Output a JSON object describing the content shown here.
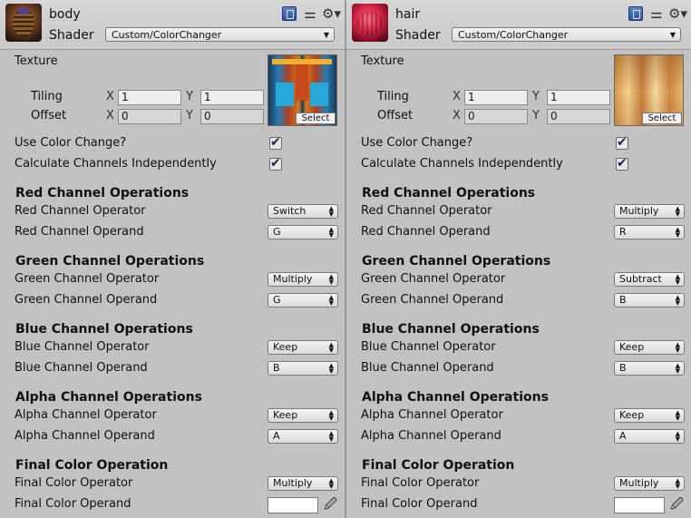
{
  "panels": [
    {
      "material_name": "body",
      "shader_label": "Shader",
      "shader_value": "Custom/ColorChanger",
      "texture_label": "Texture",
      "tiling_label": "Tiling",
      "offset_label": "Offset",
      "tiling_x": "1",
      "tiling_y": "1",
      "offset_x": "0",
      "offset_y": "0",
      "x_label": "X",
      "y_label": "Y",
      "select_label": "Select",
      "use_color_change": "Use Color Change?",
      "calc_independent": "Calculate Channels Independently",
      "red_section": "Red Channel Operations",
      "red_operator_label": "Red Channel Operator",
      "red_operator": "Switch",
      "red_operand_label": "Red Channel Operand",
      "red_operand": "G",
      "green_section": "Green Channel Operations",
      "green_operator_label": "Green Channel Operator",
      "green_operator": "Multiply",
      "green_operand_label": "Green Channel Operand",
      "green_operand": "G",
      "blue_section": "Blue Channel Operations",
      "blue_operator_label": "Blue Channel Operator",
      "blue_operator": "Keep",
      "blue_operand_label": "Blue Channel Operand",
      "blue_operand": "B",
      "alpha_section": "Alpha Channel Operations",
      "alpha_operator_label": "Alpha Channel Operator",
      "alpha_operator": "Keep",
      "alpha_operand_label": "Alpha Channel Operand",
      "alpha_operand": "A",
      "final_section": "Final Color Operation",
      "final_operator_label": "Final Color Operator",
      "final_operator": "Multiply",
      "final_operand_label": "Final Color Operand",
      "final_color": "#ffffff"
    },
    {
      "material_name": "hair",
      "shader_label": "Shader",
      "shader_value": "Custom/ColorChanger",
      "texture_label": "Texture",
      "tiling_label": "Tiling",
      "offset_label": "Offset",
      "tiling_x": "1",
      "tiling_y": "1",
      "offset_x": "0",
      "offset_y": "0",
      "x_label": "X",
      "y_label": "Y",
      "select_label": "Select",
      "use_color_change": "Use Color Change?",
      "calc_independent": "Calculate Channels Independently",
      "red_section": "Red Channel Operations",
      "red_operator_label": "Red Channel Operator",
      "red_operator": "Multiply",
      "red_operand_label": "Red Channel Operand",
      "red_operand": "R",
      "green_section": "Green Channel Operations",
      "green_operator_label": "Green Channel Operator",
      "green_operator": "Subtract",
      "green_operand_label": "Green Channel Operand",
      "green_operand": "B",
      "blue_section": "Blue Channel Operations",
      "blue_operator_label": "Blue Channel Operator",
      "blue_operator": "Keep",
      "blue_operand_label": "Blue Channel Operand",
      "blue_operand": "B",
      "alpha_section": "Alpha Channel Operations",
      "alpha_operator_label": "Alpha Channel Operator",
      "alpha_operator": "Keep",
      "alpha_operand_label": "Alpha Channel Operand",
      "alpha_operand": "A",
      "final_section": "Final Color Operation",
      "final_operator_label": "Final Color Operator",
      "final_operator": "Multiply",
      "final_operand_label": "Final Color Operand",
      "final_color": "#ffffff"
    }
  ],
  "icons": {
    "help": "help-book-icon",
    "settings_sliders": "sliders-icon",
    "gear": "gear-icon",
    "eyedropper": "eyedropper-icon"
  }
}
